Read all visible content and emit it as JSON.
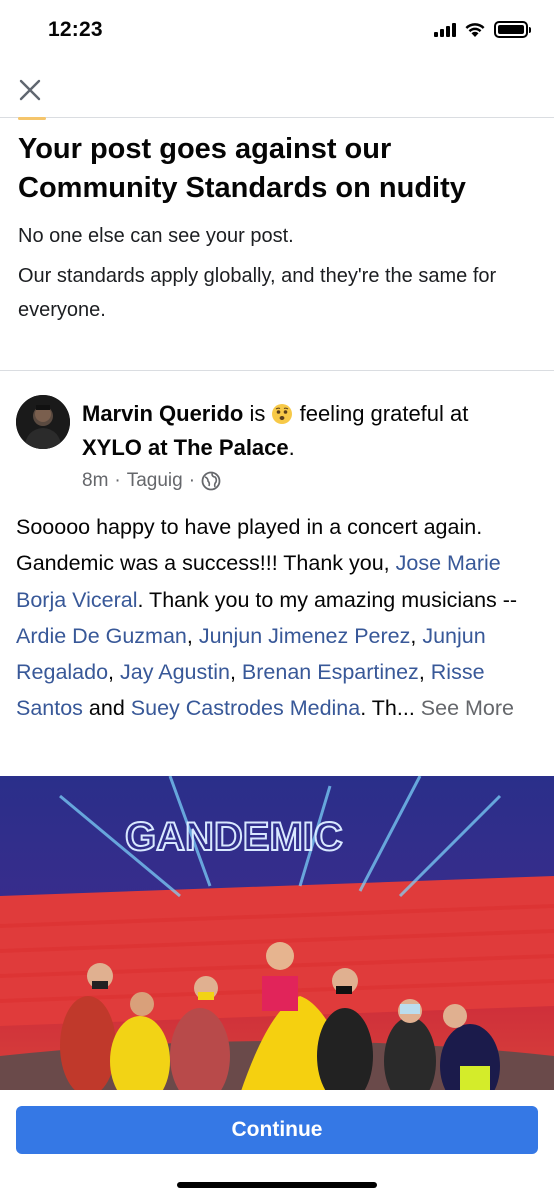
{
  "status_bar": {
    "time": "12:23"
  },
  "topbar": {
    "close_icon": "close-icon"
  },
  "notice": {
    "title": "Your post goes against our Community Standards on nudity",
    "paragraph1": "No one else can see your post.",
    "paragraph2": "Our standards apply globally, and they're the same for everyone."
  },
  "post": {
    "author": "Marvin Querido",
    "is_text": " is ",
    "feeling": " feeling grateful",
    "at_text": " at ",
    "location": "XYLO at The Palace",
    "period": ".",
    "time": "8m",
    "sep": "·",
    "place": "Taguig",
    "audience_icon": "globe-icon",
    "body": {
      "t1": "Sooooo happy to have played in a concert again. Gandemic was a success!!! Thank you, ",
      "tag1": "Jose Marie Borja Viceral",
      "t2": ". Thank you to my amazing musicians -- ",
      "tag2": "Ardie De Guzman",
      "c1": ", ",
      "tag3": "Junjun Jimenez Perez",
      "c2": ", ",
      "tag4": "Junjun Regalado",
      "c3": ", ",
      "tag5": "Jay Agustin",
      "c4": ", ",
      "tag6": "Brenan Espartinez",
      "c5": ", ",
      "tag7": "Risse Santos",
      "t3": " and ",
      "tag8": "Suey Castrodes Medina",
      "t4": ". Th... ",
      "see_more": "See More"
    },
    "photo_sign": "GANDEMIC"
  },
  "footer": {
    "continue_label": "Continue"
  },
  "colors": {
    "accent": "#3578e5",
    "link": "#385898",
    "muted": "#65676b"
  }
}
